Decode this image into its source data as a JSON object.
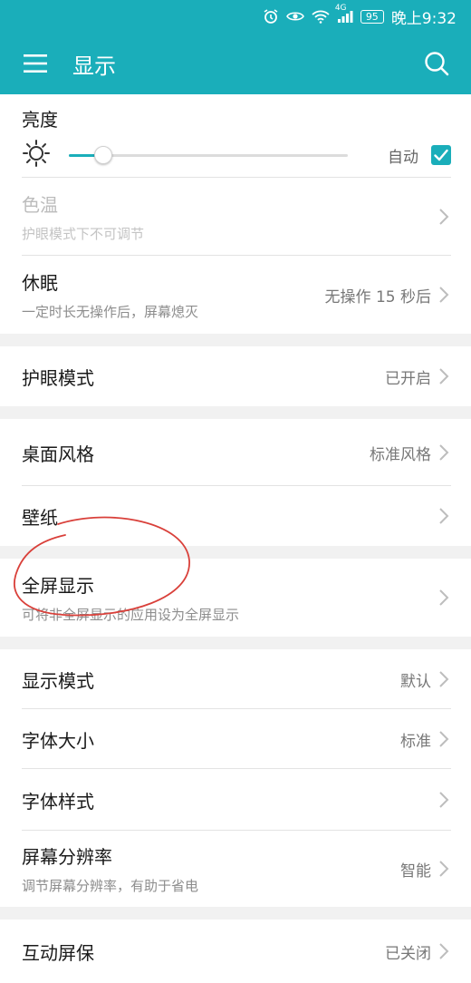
{
  "status_bar": {
    "battery": "95",
    "time": "晚上9:32",
    "network": "4G"
  },
  "header": {
    "title": "显示"
  },
  "brightness": {
    "label": "亮度",
    "auto_label": "自动",
    "auto_checked": true,
    "level_fraction": 0.12
  },
  "settings": {
    "color_temp": {
      "label": "色温",
      "sub": "护眼模式下不可调节"
    },
    "sleep": {
      "label": "休眠",
      "sub": "一定时长无操作后，屏幕熄灭",
      "value": "无操作 15 秒后"
    },
    "eye_comfort": {
      "label": "护眼模式",
      "value": "已开启"
    },
    "home_style": {
      "label": "桌面风格",
      "value": "标准风格"
    },
    "wallpaper": {
      "label": "壁纸"
    },
    "fullscreen": {
      "label": "全屏显示",
      "sub": "可将非全屏显示的应用设为全屏显示"
    },
    "display_mode": {
      "label": "显示模式",
      "value": "默认"
    },
    "font_size": {
      "label": "字体大小",
      "value": "标准"
    },
    "font_style": {
      "label": "字体样式"
    },
    "resolution": {
      "label": "屏幕分辨率",
      "sub": "调节屏幕分辨率，有助于省电",
      "value": "智能"
    },
    "screensaver": {
      "label": "互动屏保",
      "value": "已关闭"
    }
  },
  "colors": {
    "accent": "#1aaeba",
    "annotation": "#d9403a"
  },
  "icons": {
    "menu": "menu-icon",
    "search": "search-icon",
    "brightness": "sun-icon",
    "chevron": "chevron-right-icon",
    "check": "check-icon"
  }
}
